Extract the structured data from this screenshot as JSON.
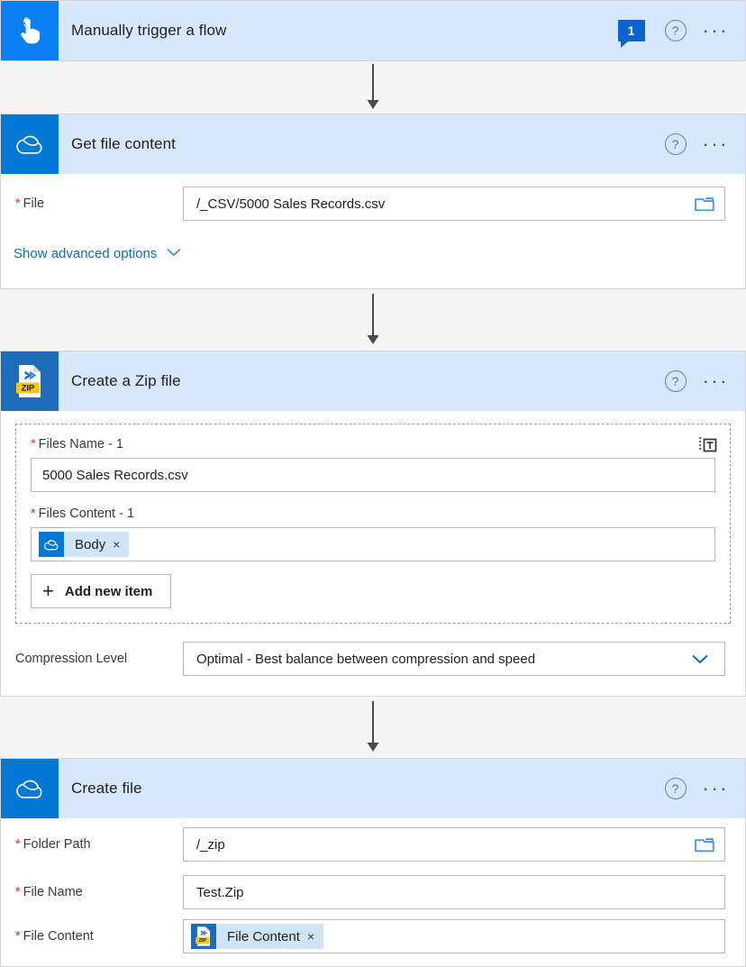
{
  "app": {
    "name": "Power Automate flow designer",
    "accent_blue": "#0078d4",
    "trigger_blue": "#0b7ef4",
    "header_blue": "#d8e8fc",
    "canvas_gray": "#f5f5f5",
    "required_red": "#d13438",
    "link_blue": "#0f6cbd",
    "token_blue": "#cfe4f7",
    "zip_yellow": "#f5c518"
  },
  "common": {
    "help_glyph": "?",
    "ellipsis_glyph": "···",
    "remove_glyph": "×",
    "plus_glyph": "+",
    "chevron_down_glyph": "∨"
  },
  "steps": [
    {
      "id": "manually-trigger-a-flow",
      "title": "Manually trigger a flow",
      "icon": "hand-tap-icon",
      "icon_style": "trigger",
      "badge": "1",
      "has_help": true,
      "has_menu": true,
      "collapsed": true
    },
    {
      "id": "get-file-content",
      "title": "Get file content",
      "icon": "onedrive-cloud-icon",
      "icon_style": "onedrive",
      "has_help": true,
      "has_menu": true,
      "fields": [
        {
          "label": "File",
          "required": true,
          "value": "/_CSV/5000 Sales Records.csv",
          "trailing_icon": "folder-picker-icon"
        }
      ],
      "advanced_link": "Show advanced options"
    },
    {
      "id": "create-a-zip-file",
      "title": "Create a Zip file",
      "icon": "zip-file-icon",
      "icon_style": "zip",
      "has_help": true,
      "has_menu": true,
      "array_group": {
        "switch_icon": "switch-to-text-mode-icon",
        "items": [
          {
            "label": "Files Name - 1",
            "required": true,
            "value": "5000 Sales Records.csv"
          },
          {
            "label": "Files Content - 1",
            "required": true,
            "token": {
              "text": "Body",
              "icon": "onedrive-cloud-icon",
              "icon_style": "onedrive"
            }
          }
        ],
        "add_button": "Add new item"
      },
      "fields": [
        {
          "label": "Compression Level",
          "required": false,
          "value": "Optimal - Best balance between compression and speed",
          "trailing_icon": "chevron-down-icon"
        }
      ]
    },
    {
      "id": "create-file",
      "title": "Create file",
      "icon": "onedrive-cloud-icon",
      "icon_style": "onedrive",
      "has_help": true,
      "has_menu": true,
      "fields": [
        {
          "label": "Folder Path",
          "required": true,
          "value": "/_zip",
          "trailing_icon": "folder-picker-icon"
        },
        {
          "label": "File Name",
          "required": true,
          "value": "Test.Zip"
        },
        {
          "label": "File Content",
          "required": true,
          "token": {
            "text": "File Content",
            "icon": "zip-file-icon",
            "icon_style": "zip"
          }
        }
      ]
    }
  ]
}
